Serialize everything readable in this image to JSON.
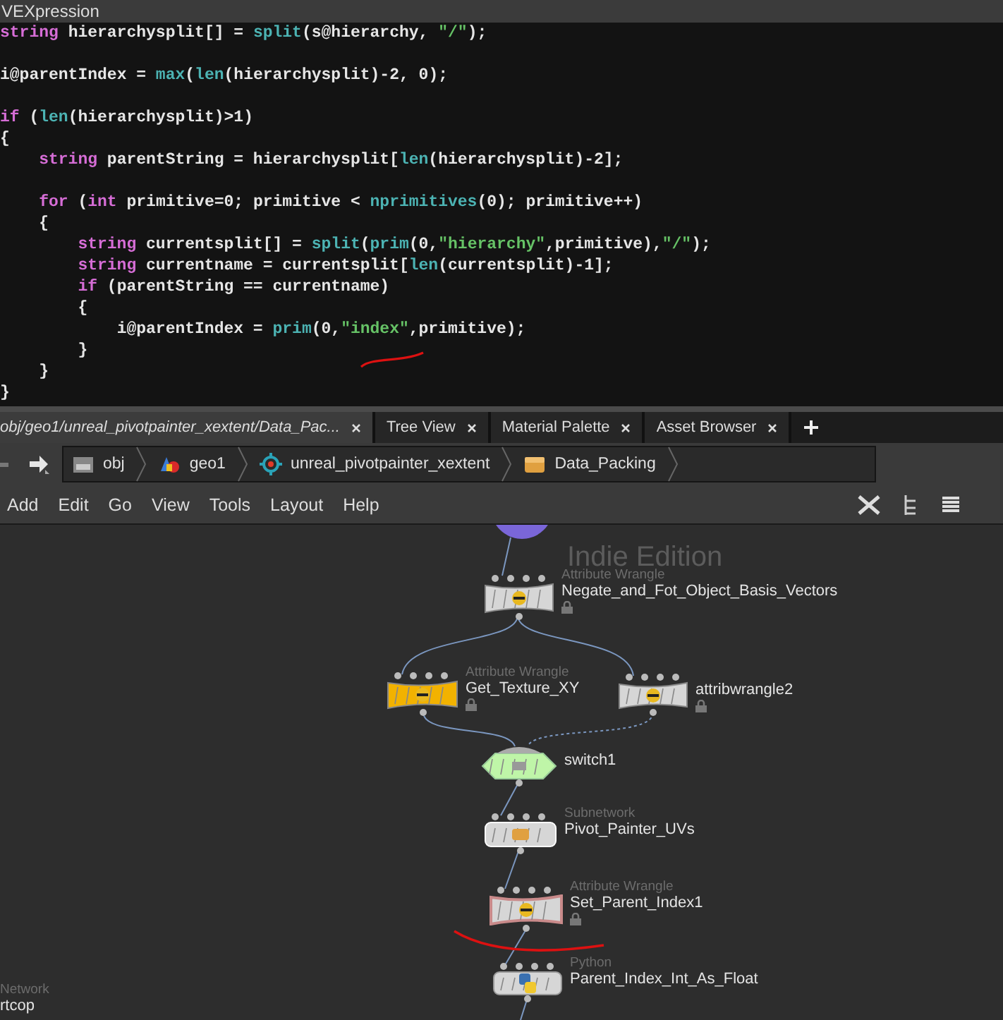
{
  "code_editor": {
    "title": "VEXpression",
    "lines": [
      {
        "gap_after": true,
        "tokens": [
          {
            "kind": "kw",
            "text": "string"
          },
          {
            "kind": "p",
            "text": " hierarchysplit[] = "
          },
          {
            "kind": "fn",
            "text": "split"
          },
          {
            "kind": "p",
            "text": "(s@hierarchy, "
          },
          {
            "kind": "str",
            "text": "\"/\""
          },
          {
            "kind": "p",
            "text": ");"
          }
        ]
      },
      {
        "gap_after": true,
        "tokens": [
          {
            "kind": "p",
            "text": "i@parentIndex = "
          },
          {
            "kind": "fn",
            "text": "max"
          },
          {
            "kind": "p",
            "text": "("
          },
          {
            "kind": "fn",
            "text": "len"
          },
          {
            "kind": "p",
            "text": "(hierarchysplit)-2, 0);"
          }
        ]
      },
      {
        "gap_after": false,
        "tokens": [
          {
            "kind": "kw",
            "text": "if"
          },
          {
            "kind": "p",
            "text": " ("
          },
          {
            "kind": "fn",
            "text": "len"
          },
          {
            "kind": "p",
            "text": "(hierarchysplit)>1)"
          }
        ]
      },
      {
        "gap_after": false,
        "tokens": [
          {
            "kind": "p",
            "text": "{"
          }
        ],
        "children": [
          {
            "gap_after": true,
            "tokens": [
              {
                "kind": "kw",
                "text": "string"
              },
              {
                "kind": "p",
                "text": " parentString = hierarchysplit["
              },
              {
                "kind": "fn",
                "text": "len"
              },
              {
                "kind": "p",
                "text": "(hierarchysplit)-2];"
              }
            ]
          },
          {
            "gap_after": false,
            "tokens": [
              {
                "kind": "kw",
                "text": "for"
              },
              {
                "kind": "p",
                "text": " ("
              },
              {
                "kind": "kw",
                "text": "int"
              },
              {
                "kind": "p",
                "text": " primitive=0; primitive < "
              },
              {
                "kind": "fn",
                "text": "nprimitives"
              },
              {
                "kind": "p",
                "text": "(0); primitive++)"
              }
            ]
          },
          {
            "gap_after": false,
            "tokens": [
              {
                "kind": "p",
                "text": "{"
              }
            ],
            "children": [
              {
                "gap_after": false,
                "tokens": [
                  {
                    "kind": "kw",
                    "text": "string"
                  },
                  {
                    "kind": "p",
                    "text": " currentsplit[] = "
                  },
                  {
                    "kind": "fn",
                    "text": "split"
                  },
                  {
                    "kind": "p",
                    "text": "("
                  },
                  {
                    "kind": "fn",
                    "text": "prim"
                  },
                  {
                    "kind": "p",
                    "text": "(0,"
                  },
                  {
                    "kind": "str",
                    "text": "\"hierarchy\""
                  },
                  {
                    "kind": "p",
                    "text": ",primitive),"
                  },
                  {
                    "kind": "str",
                    "text": "\"/\""
                  },
                  {
                    "kind": "p",
                    "text": ");"
                  }
                ]
              },
              {
                "gap_after": false,
                "tokens": [
                  {
                    "kind": "kw",
                    "text": "string"
                  },
                  {
                    "kind": "p",
                    "text": " currentname = currentsplit["
                  },
                  {
                    "kind": "fn",
                    "text": "len"
                  },
                  {
                    "kind": "p",
                    "text": "(currentsplit)-1];"
                  }
                ]
              },
              {
                "gap_after": false,
                "tokens": [
                  {
                    "kind": "kw",
                    "text": "if"
                  },
                  {
                    "kind": "p",
                    "text": " (parentString == currentname)"
                  }
                ]
              },
              {
                "gap_after": false,
                "tokens": [
                  {
                    "kind": "p",
                    "text": "{"
                  }
                ],
                "children": [
                  {
                    "gap_after": false,
                    "tokens": [
                      {
                        "kind": "p",
                        "text": "i@parentIndex = "
                      },
                      {
                        "kind": "fn",
                        "text": "prim"
                      },
                      {
                        "kind": "p",
                        "text": "(0,"
                      },
                      {
                        "kind": "str",
                        "text": "\"index\""
                      },
                      {
                        "kind": "p",
                        "text": ",primitive);"
                      }
                    ]
                  }
                ]
              },
              {
                "gap_after": false,
                "tokens": [
                  {
                    "kind": "p",
                    "text": "}"
                  }
                ]
              }
            ]
          },
          {
            "gap_after": false,
            "tokens": [
              {
                "kind": "p",
                "text": "}"
              }
            ]
          }
        ]
      },
      {
        "gap_after": false,
        "tokens": [
          {
            "kind": "p",
            "text": "}"
          }
        ]
      }
    ]
  },
  "tabs": [
    {
      "label": "obj/geo1/unreal_pivotpainter_xextent/Data_Pac...",
      "selected": true
    },
    {
      "label": "Tree View",
      "selected": false
    },
    {
      "label": "Material Palette",
      "selected": false
    },
    {
      "label": "Asset Browser",
      "selected": false
    }
  ],
  "path_bar": {
    "crumbs": [
      {
        "label": "obj",
        "kind": "obj"
      },
      {
        "label": "geo1",
        "kind": "geo"
      },
      {
        "label": "unreal_pivotpainter_xextent",
        "kind": "target"
      },
      {
        "label": "Data_Packing",
        "kind": "box"
      }
    ]
  },
  "menu": [
    "Add",
    "Edit",
    "Go",
    "View",
    "Tools",
    "Layout",
    "Help"
  ],
  "network": {
    "watermark": "Indie Edition",
    "nodes": [
      {
        "kind": "wrangle",
        "type_label": "Attribute Wrangle",
        "name": "Negate_and_Fot_Object_Basis_Vectors",
        "color": "#d6d6d6",
        "locked": true,
        "selected": false
      },
      {
        "kind": "wrangle",
        "type_label": "Attribute Wrangle",
        "name": "Get_Texture_XY",
        "color": "#f2b200",
        "locked": true,
        "selected": false
      },
      {
        "kind": "wrangle",
        "name": "attribwrangle2",
        "color": "#d6d6d6",
        "locked": true,
        "selected": false
      },
      {
        "kind": "switch",
        "name": "switch1",
        "color": "#bff5a8",
        "locked": false,
        "selected": false
      },
      {
        "kind": "subnet",
        "type_label": "Subnetwork",
        "name": "Pivot_Painter_UVs",
        "color": "#d6d6d6",
        "locked": false,
        "selected": false
      },
      {
        "kind": "wrangle",
        "type_label": "Attribute Wrangle",
        "name": "Set_Parent_Index1",
        "color": "#d6d6d6",
        "locked": true,
        "selected": true
      },
      {
        "kind": "python",
        "type_label": "Python",
        "name": "Parent_Index_Int_As_Float",
        "color": "#d6d6d6",
        "locked": false,
        "selected": false
      }
    ],
    "partial_node": {
      "type_label": "Network",
      "name": "rtcop"
    }
  }
}
